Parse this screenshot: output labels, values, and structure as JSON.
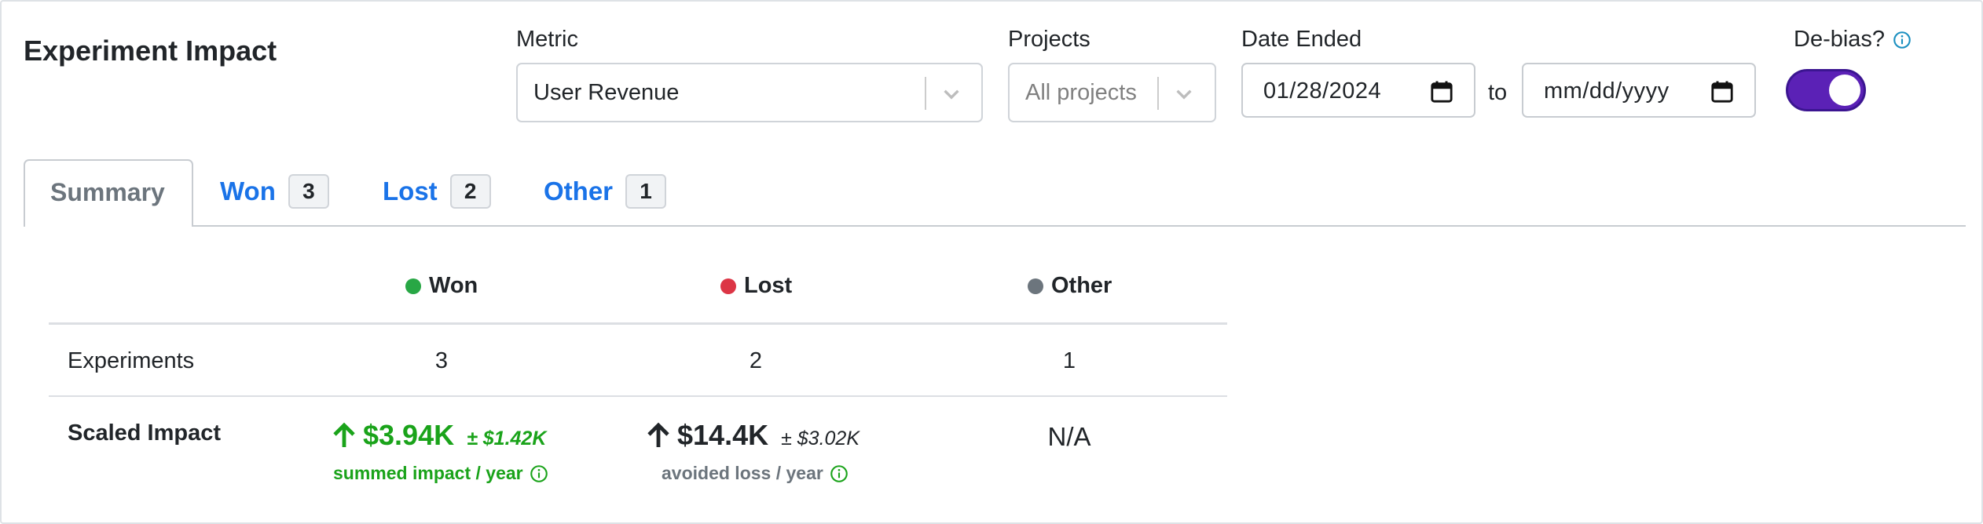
{
  "header": {
    "title": "Experiment Impact"
  },
  "filters": {
    "metric": {
      "label": "Metric",
      "value": "User Revenue"
    },
    "projects": {
      "label": "Projects",
      "placeholder": "All projects"
    },
    "date": {
      "label": "Date Ended",
      "start": "01/28/2024",
      "end_placeholder": "mm/dd/yyyy",
      "separator": "to"
    },
    "debias": {
      "label": "De-bias?",
      "enabled": true
    }
  },
  "tabs": [
    {
      "label": "Summary",
      "active": true
    },
    {
      "label": "Won",
      "count": "3"
    },
    {
      "label": "Lost",
      "count": "2"
    },
    {
      "label": "Other",
      "count": "1"
    }
  ],
  "table": {
    "columns": [
      {
        "label": "Won",
        "color": "#28a745"
      },
      {
        "label": "Lost",
        "color": "#dc3545"
      },
      {
        "label": "Other",
        "color": "#6c757d"
      }
    ],
    "rows": {
      "experiments": {
        "label": "Experiments",
        "values": [
          "3",
          "2",
          "1"
        ]
      },
      "scaled_impact": {
        "label": "Scaled Impact",
        "won": {
          "value": "$3.94K",
          "ci": "± $1.42K",
          "caption": "summed impact / year"
        },
        "lost": {
          "value": "$14.4K",
          "ci": "± $3.02K",
          "caption": "avoided loss / year"
        },
        "other": {
          "value": "N/A"
        }
      }
    }
  },
  "icons": [
    "chevron-down-icon",
    "calendar-icon",
    "info-icon",
    "arrow-up-icon"
  ],
  "colors": {
    "accent": "#1a73e8",
    "toggle": "#5b21b6",
    "won": "#1aa31a",
    "lost": "#dc3545",
    "other": "#6c757d"
  }
}
